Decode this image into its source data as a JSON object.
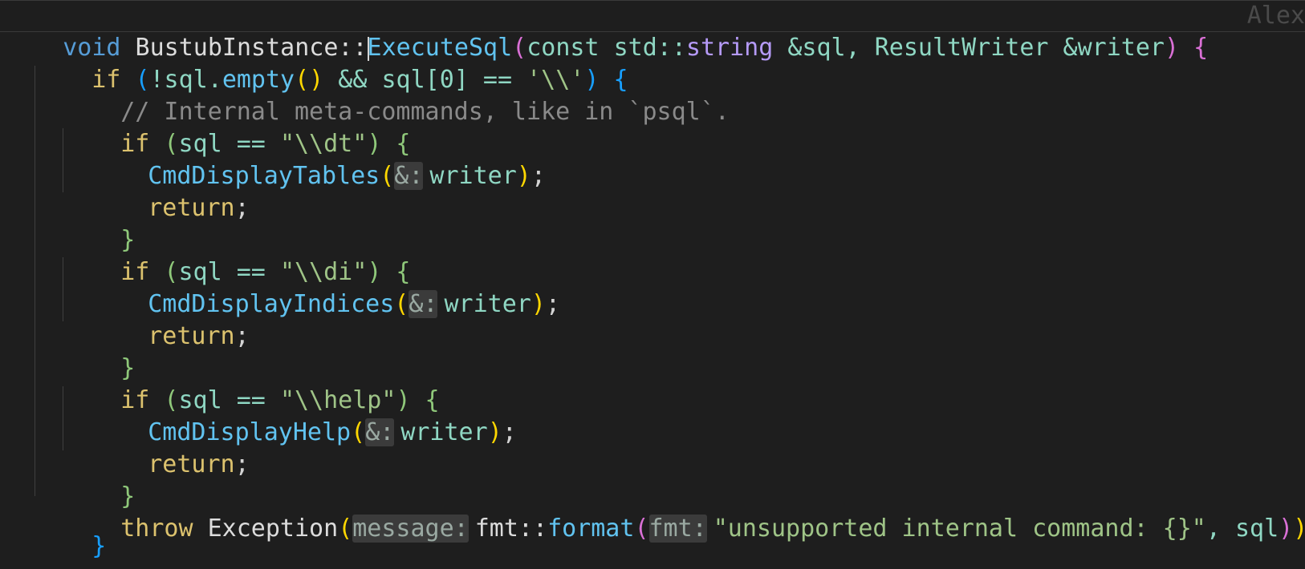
{
  "editor": {
    "blame_author": "Alex",
    "lines": [
      {
        "tokens": {
          "t0": "void",
          "t1": " BustubInstance::",
          "t2": "ExecuteSql",
          "t3": "(",
          "t4": "const",
          "t5": " std::",
          "t6": "string",
          "t7": " &sql, ResultWriter &writer",
          "t8": ")",
          "t9": " {"
        }
      },
      {
        "tokens": {
          "t0": "if",
          "t1": " ",
          "t2": "(",
          "t3": "!sql.",
          "t4": "empty",
          "t5": "()",
          "t6": " && sql[0] == ",
          "t7": "'\\\\'",
          "t8": ")",
          "t9": " {"
        }
      },
      {
        "tokens": {
          "t0": "// Internal meta-commands, like in `psql`."
        }
      },
      {
        "tokens": {
          "t0": "if",
          "t1": " (",
          "t2": "sql == ",
          "t3": "\"\\\\dt\"",
          "t4": ")",
          "t5": " {"
        }
      },
      {
        "tokens": {
          "t0": "CmdDisplayTables",
          "t1": "(",
          "t2": "&:",
          "t3": "writer",
          "t4": ")",
          "t5": ";"
        }
      },
      {
        "tokens": {
          "t0": "return",
          "t1": ";"
        }
      },
      {
        "tokens": {
          "t0": "}"
        }
      },
      {
        "tokens": {
          "t0": "if",
          "t1": " (",
          "t2": "sql == ",
          "t3": "\"\\\\di\"",
          "t4": ")",
          "t5": " {"
        }
      },
      {
        "tokens": {
          "t0": "CmdDisplayIndices",
          "t1": "(",
          "t2": "&:",
          "t3": "writer",
          "t4": ")",
          "t5": ";"
        }
      },
      {
        "tokens": {
          "t0": "return",
          "t1": ";"
        }
      },
      {
        "tokens": {
          "t0": "}"
        }
      },
      {
        "tokens": {
          "t0": "if",
          "t1": " (",
          "t2": "sql == ",
          "t3": "\"\\\\help\"",
          "t4": ")",
          "t5": " {"
        }
      },
      {
        "tokens": {
          "t0": "CmdDisplayHelp",
          "t1": "(",
          "t2": "&:",
          "t3": "writer",
          "t4": ")",
          "t5": ";"
        }
      },
      {
        "tokens": {
          "t0": "return",
          "t1": ";"
        }
      },
      {
        "tokens": {
          "t0": "}"
        }
      },
      {
        "tokens": {
          "t0": "throw",
          "t1": " Exception",
          "t2": "(",
          "t3": "message:",
          "t4": "fmt::",
          "t5": "format",
          "t6": "(",
          "t7": "fmt:",
          "t8": "\"unsupported internal command: {}\"",
          "t9": ", sql",
          "t10": ")",
          "t11": ")",
          "t12": ";"
        }
      },
      {
        "tokens": {
          "t0": "}"
        }
      }
    ]
  }
}
